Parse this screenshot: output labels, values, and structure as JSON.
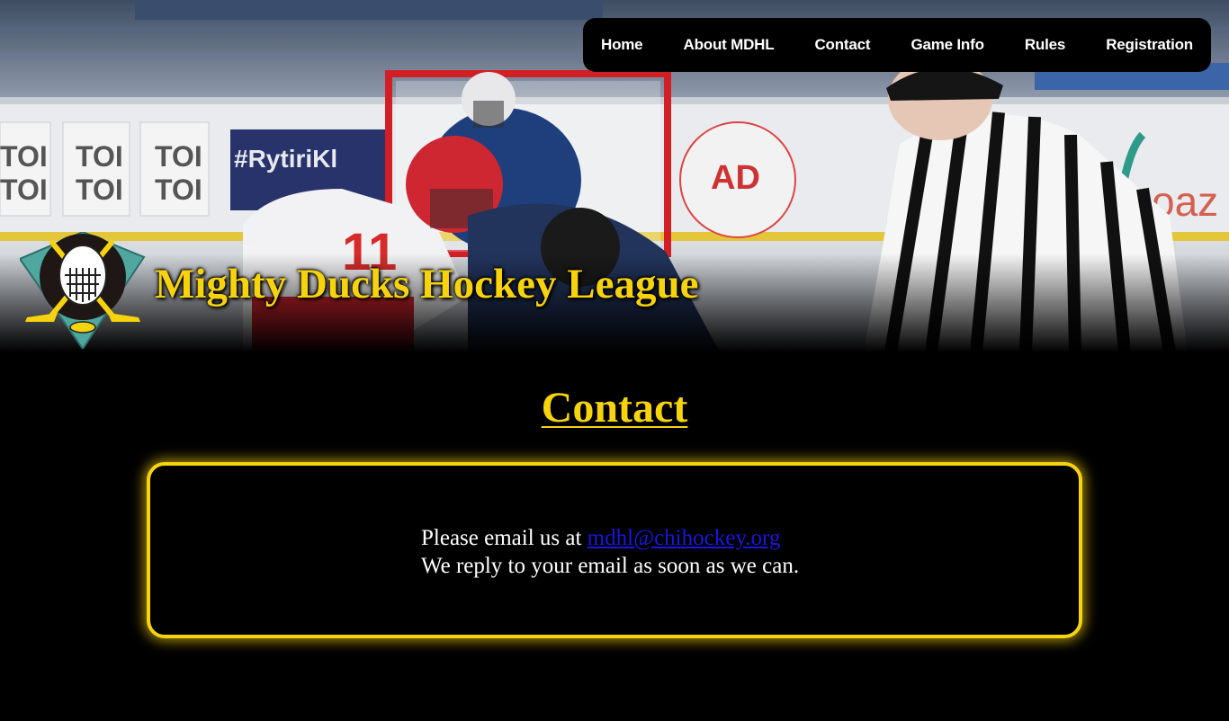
{
  "nav": {
    "items": [
      {
        "label": "Home"
      },
      {
        "label": "About MDHL"
      },
      {
        "label": "Contact"
      },
      {
        "label": "Game Info"
      },
      {
        "label": "Rules"
      },
      {
        "label": "Registration"
      }
    ]
  },
  "header": {
    "site_title": "Mighty Ducks Hockey League",
    "logo_icon": "hockey-goalie-mask-crossed-sticks-logo"
  },
  "main": {
    "heading": "Contact",
    "contact": {
      "line1_prefix": "Please email us at",
      "email": "mdhl@chihockey.org",
      "line2": "We reply to your email as soon as we can."
    }
  },
  "colors": {
    "accent_yellow": "#f7d30e",
    "link_blue": "#1a16e0",
    "background": "#000000",
    "nav_background": "#000000"
  }
}
